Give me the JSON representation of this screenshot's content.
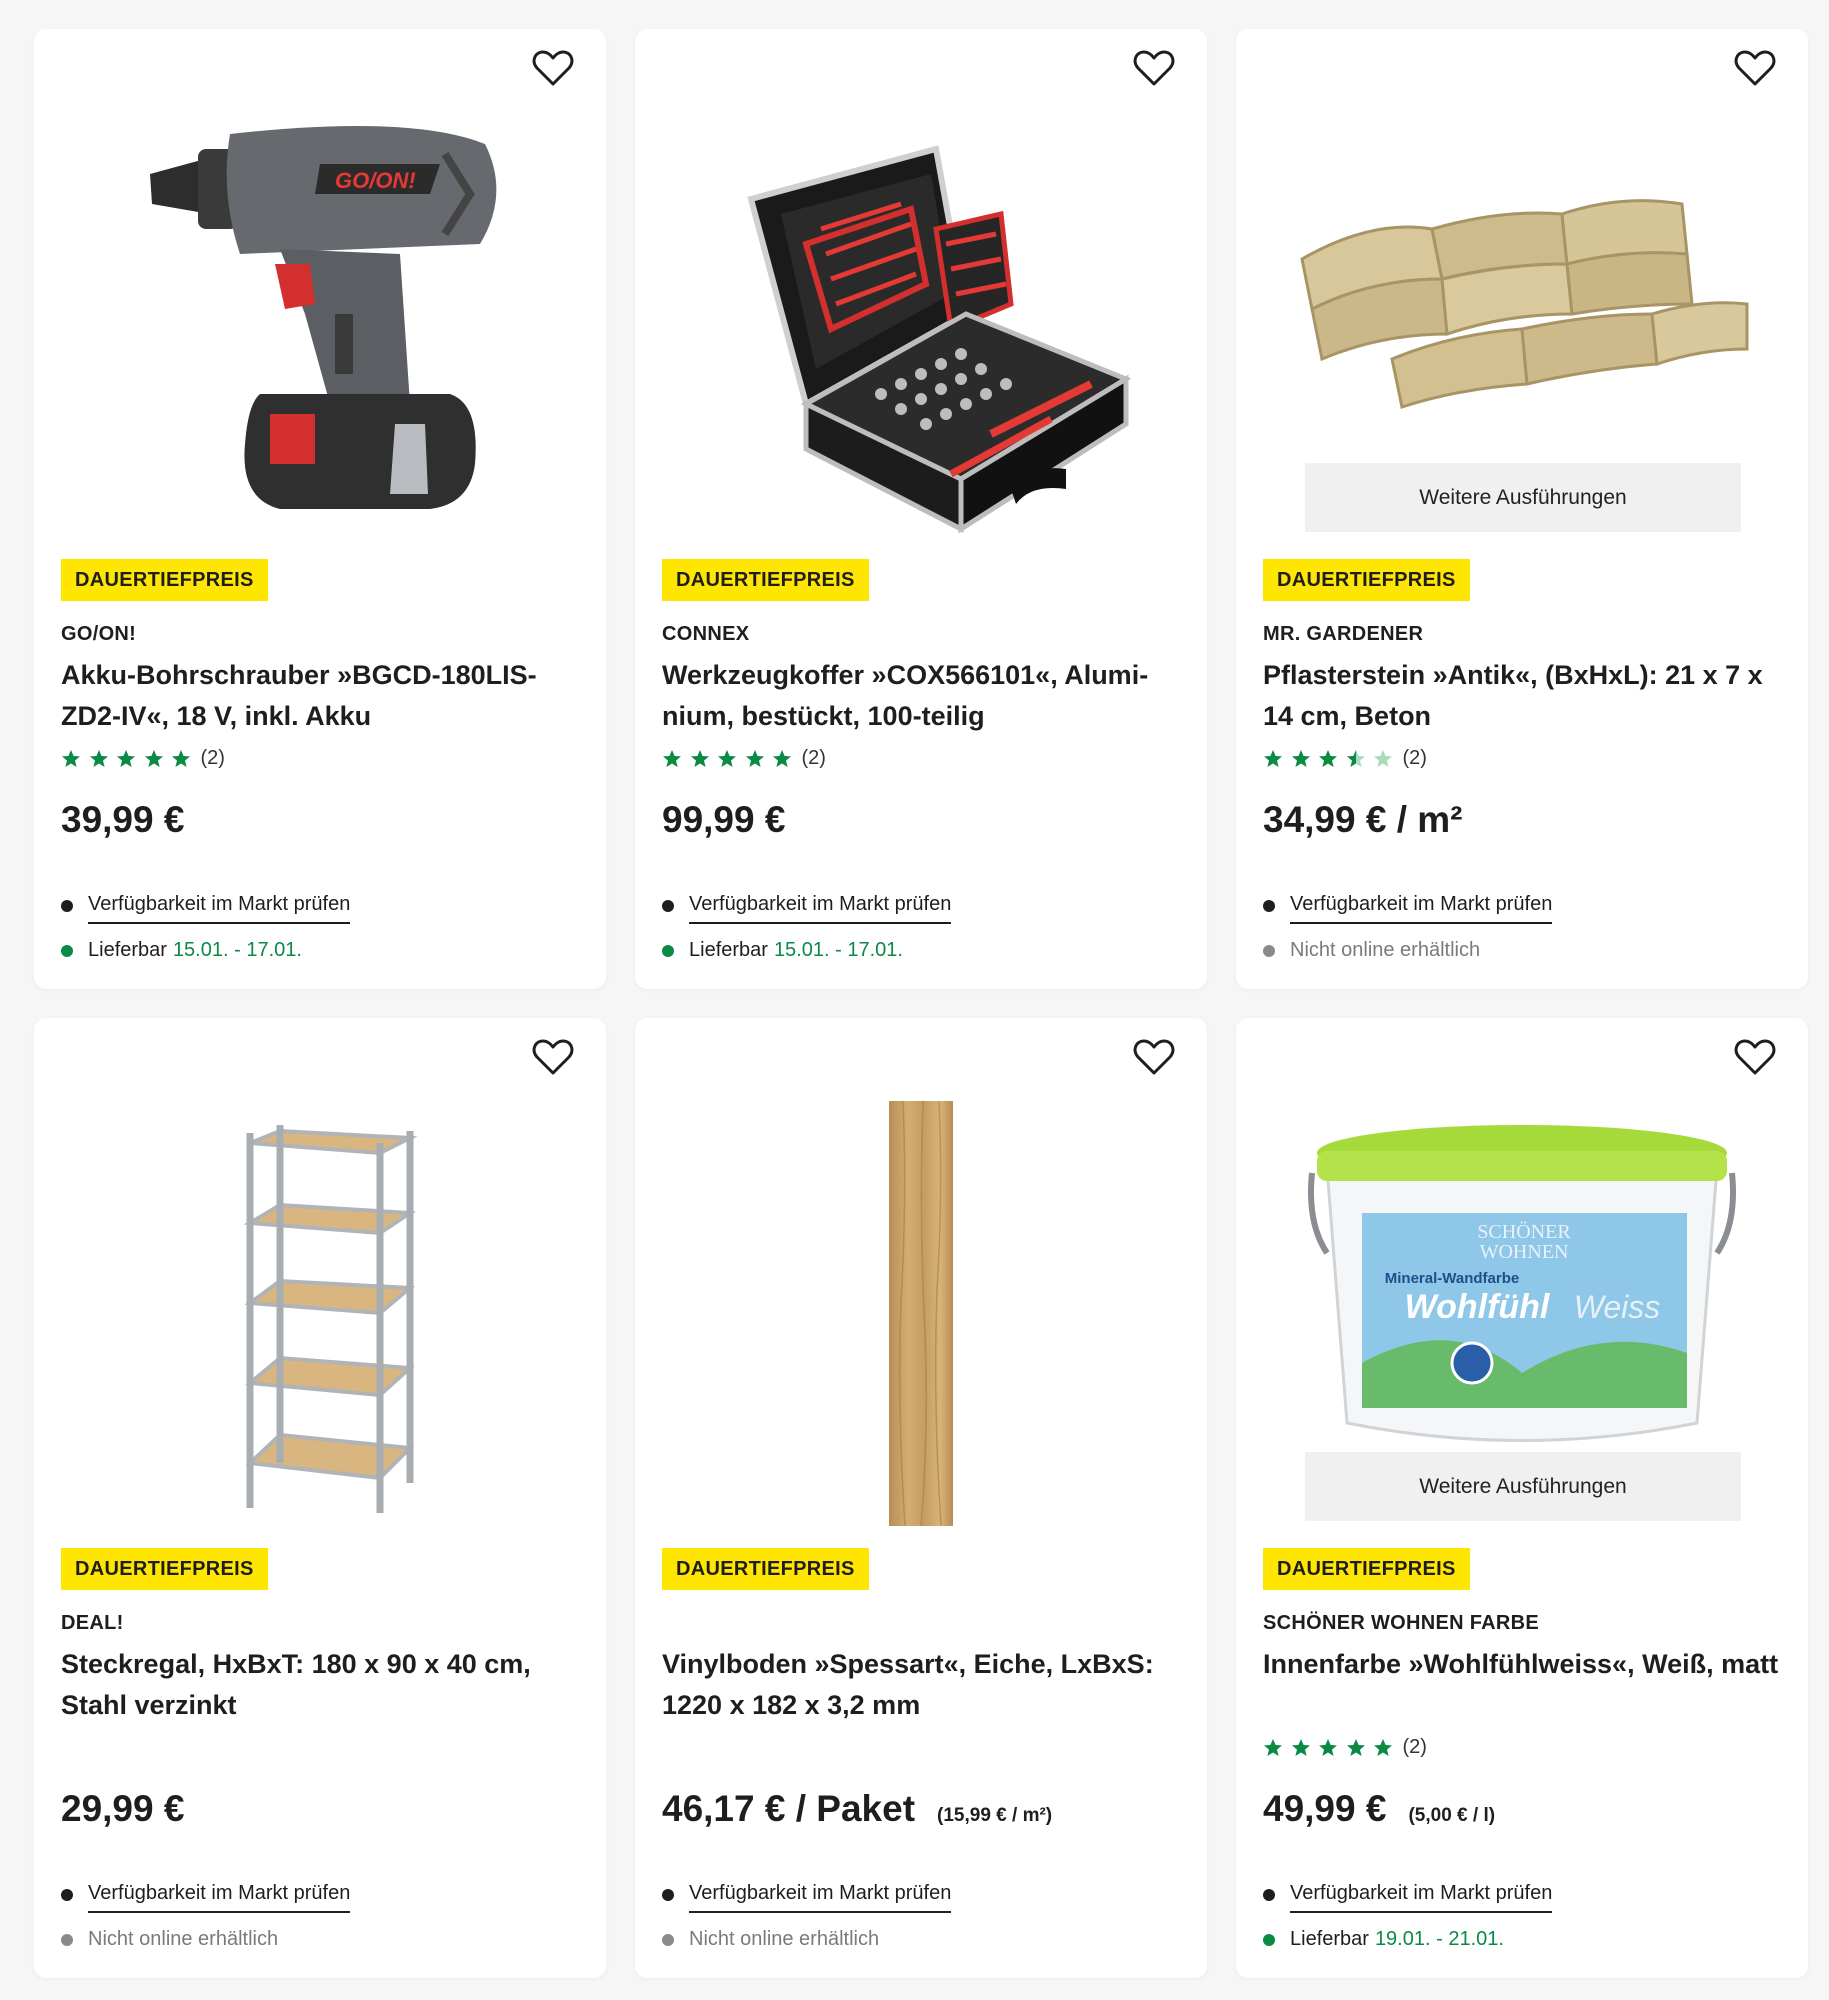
{
  "colors": {
    "badge": "#ffe600",
    "star": "#0a8a45",
    "available_dot": "#0a8a45",
    "unavailable_dot": "#8a8a8a"
  },
  "products": [
    {
      "badge": "DAUERTIEFPREIS",
      "brand": "GO/ON!",
      "title": "Akku-Bohrschrauber »BGCD-180LIS-ZD2-IV«, 18 V, inkl. Akku",
      "rating": {
        "stars": 5,
        "count": "(2)"
      },
      "price": "39,99 €",
      "unit_price": "",
      "availability_link": "Verfügbarkeit im Markt prüfen",
      "delivery_label": "Lieferbar",
      "delivery_dates": "15.01. - 17.01.",
      "image": "cordless-drill-image",
      "variants": ""
    },
    {
      "badge": "DAUERTIEFPREIS",
      "brand": "CONNEX",
      "title": "Werkzeugkoffer »COX566101«, Alumi-nium, bestückt, 100-teilig",
      "rating": {
        "stars": 5,
        "count": "(2)"
      },
      "price": "99,99 €",
      "unit_price": "",
      "availability_link": "Verfügbarkeit im Markt prüfen",
      "delivery_label": "Lieferbar",
      "delivery_dates": "15.01. - 17.01.",
      "image": "tool-case-image",
      "variants": ""
    },
    {
      "badge": "DAUERTIEFPREIS",
      "brand": "MR. GARDENER",
      "title": "Pflasterstein »Antik«, (BxHxL): 21 x 7 x 14 cm, Beton",
      "rating": {
        "stars": 3.5,
        "count": "(2)"
      },
      "price": "34,99 € / m²",
      "unit_price": "",
      "availability_link": "Verfügbarkeit im Markt prüfen",
      "delivery_label": "Nicht online erhältlich",
      "delivery_dates": "",
      "image": "paving-stones-image",
      "variants": "Weitere Ausführungen"
    },
    {
      "badge": "DAUERTIEFPREIS",
      "brand": "DEAL!",
      "title": "Steckregal, HxBxT: 180 x 90 x 40 cm, Stahl verzinkt",
      "rating": null,
      "price": "29,99 €",
      "unit_price": "",
      "availability_link": "Verfügbarkeit im Markt prüfen",
      "delivery_label": "Nicht online erhältlich",
      "delivery_dates": "",
      "image": "metal-shelf-image",
      "variants": ""
    },
    {
      "badge": "DAUERTIEFPREIS",
      "brand": "",
      "title": "Vinylboden »Spessart«, Eiche, LxBxS: 1220 x 182 x 3,2 mm",
      "rating": null,
      "price": "46,17 € / Paket",
      "unit_price": "(15,99 € / m²)",
      "availability_link": "Verfügbarkeit im Markt prüfen",
      "delivery_label": "Nicht online erhältlich",
      "delivery_dates": "",
      "image": "vinyl-plank-image",
      "variants": ""
    },
    {
      "badge": "DAUERTIEFPREIS",
      "brand": "SCHÖNER WOHNEN FARBE",
      "title": "Innenfarbe »Wohlfühlweiss«, Weiß, matt",
      "rating": {
        "stars": 5,
        "count": "(2)"
      },
      "price": "49,99 €",
      "unit_price": "(5,00 € / l)",
      "availability_link": "Verfügbarkeit im Markt prüfen",
      "delivery_label": "Lieferbar",
      "delivery_dates": "19.01. - 21.01.",
      "image": "paint-bucket-image",
      "variants": "Weitere Ausführungen"
    }
  ],
  "paint_bucket_label": {
    "line1": "SCHÖNER",
    "line2": "WOHNEN",
    "line3": "Mineral-Wandfarbe",
    "line4": "Wohlfühl",
    "line5": "Weiss"
  },
  "drill_brand_label": "GO/ON!"
}
